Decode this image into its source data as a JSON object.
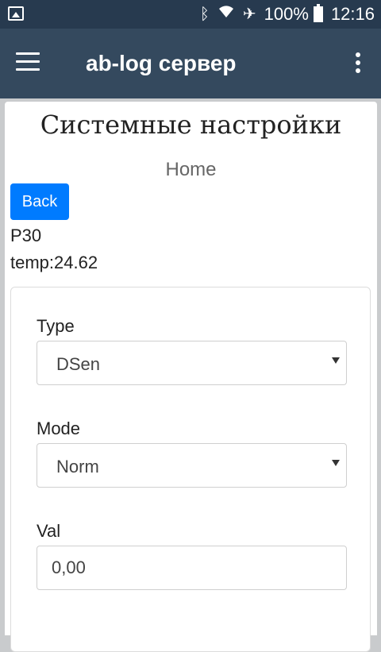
{
  "status_bar": {
    "battery_text": "100%",
    "time": "12:16",
    "icons": [
      "image-icon",
      "bluetooth-icon",
      "wifi-icon",
      "airplane-icon",
      "battery-icon"
    ]
  },
  "app_bar": {
    "title": "ab-log сервер",
    "menu_icon": "hamburger-icon",
    "overflow_icon": "more-vert-icon"
  },
  "page": {
    "title": "Системные настройки",
    "home_link": "Home",
    "back_label": "Back",
    "device_name": "P30",
    "temp": "temp:24.62"
  },
  "form": {
    "type": {
      "label": "Type",
      "value": "DSen"
    },
    "mode": {
      "label": "Mode",
      "value": "Norm"
    },
    "val": {
      "label": "Val",
      "value": "0,00"
    }
  },
  "colors": {
    "status_bar": "#273a4f",
    "app_bar": "#34495e",
    "primary_button": "#007bff"
  }
}
